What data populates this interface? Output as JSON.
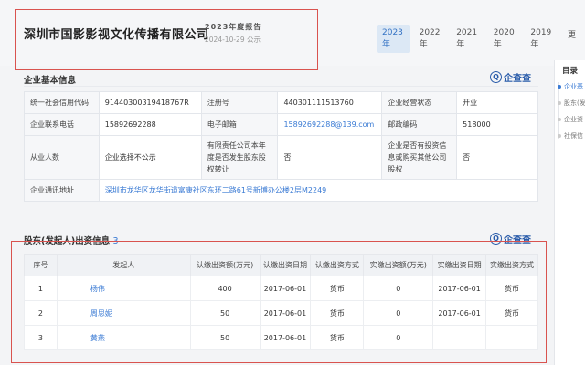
{
  "header": {
    "company_name": "深圳市国影影视文化传播有限公司",
    "report_title": "2023年度报告",
    "report_date": "2024-10-29 公示"
  },
  "year_tabs": [
    "2023年",
    "2022年",
    "2021年",
    "2020年",
    "2019年",
    "更"
  ],
  "basic_info": {
    "title": "企业基本信息",
    "badge": "企查查",
    "rows": [
      [
        {
          "label": "统一社会信用代码",
          "value": "91440300319418767R"
        },
        {
          "label": "注册号",
          "value": "440301111513760"
        },
        {
          "label": "企业经营状态",
          "value": "开业"
        }
      ],
      [
        {
          "label": "企业联系电话",
          "value": "15892692288"
        },
        {
          "label": "电子邮箱",
          "value": "15892692288@139.com"
        },
        {
          "label": "邮政编码",
          "value": "518000"
        }
      ],
      [
        {
          "label": "从业人数",
          "value": "企业选择不公示"
        },
        {
          "label": "有限责任公司本年度是否发生股东股权转让",
          "value": "否"
        },
        {
          "label": "企业是否有投资信息或购买其他公司股权",
          "value": "否"
        }
      ]
    ],
    "address_label": "企业通讯地址",
    "address_value": "深圳市龙华区龙华街道富康社区东环二路61号新博办公楼2层M2249"
  },
  "shareholders": {
    "title": "股东(发起人)出资信息",
    "count": "3",
    "badge": "企查查",
    "columns": [
      "序号",
      "发起人",
      "认缴出资额(万元)",
      "认缴出资日期",
      "认缴出资方式",
      "实缴出资额(万元)",
      "实缴出资日期",
      "实缴出资方式"
    ],
    "rows": [
      [
        "1",
        "杨伟",
        "400",
        "2017-06-01",
        "货币",
        "0",
        "2017-06-01",
        "货币"
      ],
      [
        "2",
        "周思妮",
        "50",
        "2017-06-01",
        "货币",
        "0",
        "2017-06-01",
        "货币"
      ],
      [
        "3",
        "黄燕",
        "50",
        "2017-06-01",
        "货币",
        "0",
        "",
        ""
      ]
    ]
  },
  "sidebar": {
    "title": "目录",
    "items": [
      "企业基",
      "股东(发",
      "企业资",
      "社保信"
    ]
  },
  "colors": {
    "accent": "#3b7bd4",
    "highlight_border": "#d9534f",
    "brand": "#2a5caa"
  }
}
